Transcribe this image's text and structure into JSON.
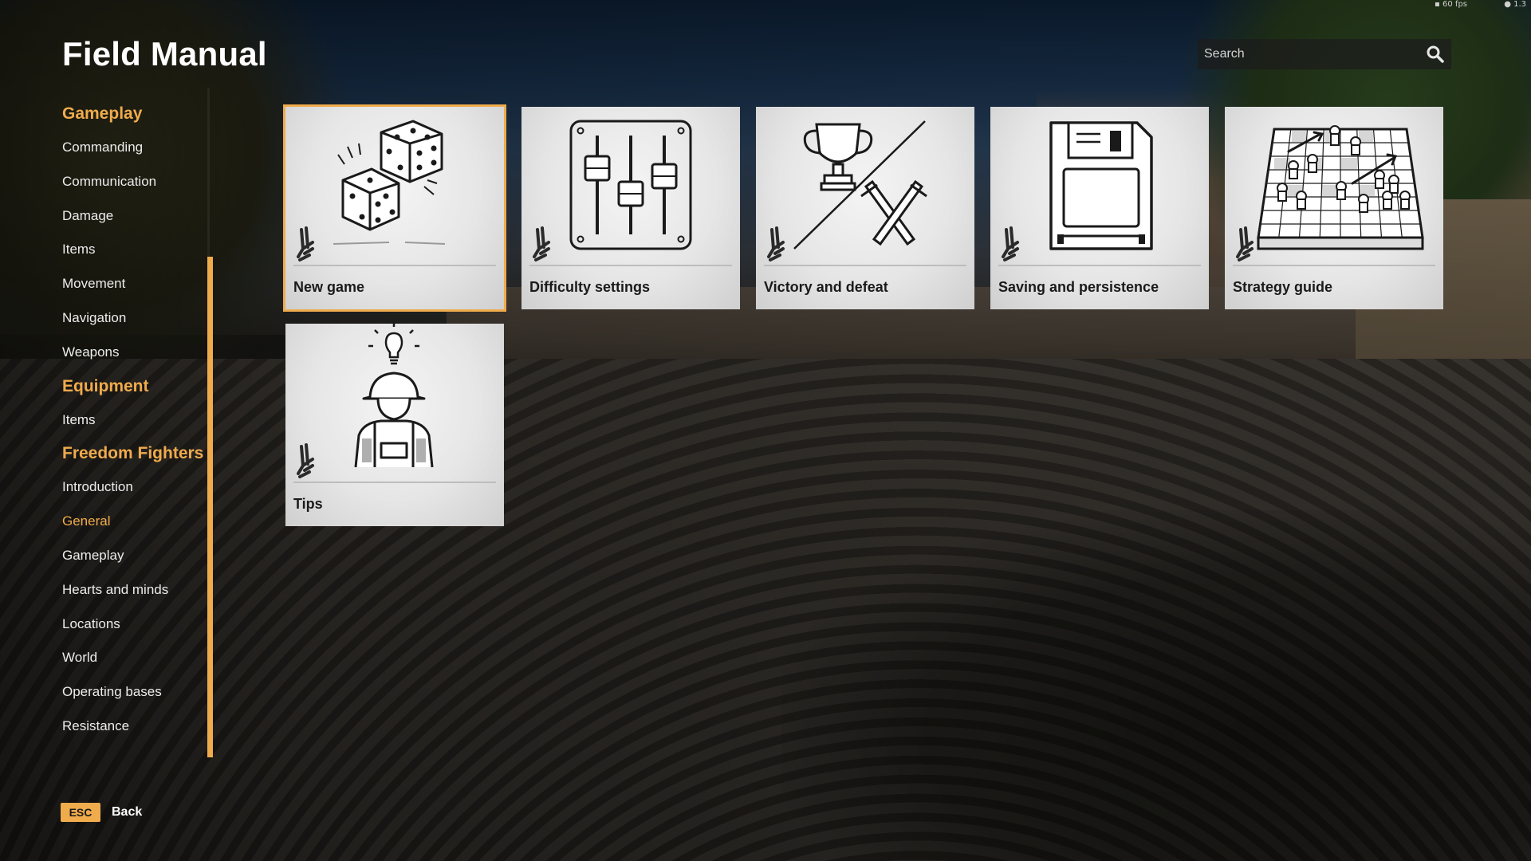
{
  "hud": {
    "fps": "60 fps",
    "version": "1.3"
  },
  "page": {
    "title": "Field Manual"
  },
  "search": {
    "placeholder": "Search",
    "icon": "search-icon"
  },
  "sidebar": {
    "sections": [
      {
        "title": "Gameplay",
        "items": [
          "Commanding",
          "Communication",
          "Damage",
          "Items",
          "Movement",
          "Navigation",
          "Weapons"
        ]
      },
      {
        "title": "Equipment",
        "items": [
          "Items"
        ]
      },
      {
        "title": "Freedom Fighters",
        "items": [
          "Introduction",
          "General",
          "Gameplay",
          "Hearts and minds",
          "Locations",
          "World",
          "Operating bases",
          "Resistance"
        ]
      }
    ],
    "active_item": "General"
  },
  "cards": [
    {
      "label": "New game",
      "icon": "dice-icon",
      "selected": true
    },
    {
      "label": "Difficulty settings",
      "icon": "sliders-icon",
      "selected": false
    },
    {
      "label": "Victory and defeat",
      "icon": "trophy-swords-icon",
      "selected": false
    },
    {
      "label": "Saving and persistence",
      "icon": "floppy-disk-icon",
      "selected": false
    },
    {
      "label": "Strategy guide",
      "icon": "chess-board-icon",
      "selected": false
    },
    {
      "label": "Tips",
      "icon": "soldier-lightbulb-icon",
      "selected": false
    }
  ],
  "footer": {
    "key": "ESC",
    "label": "Back"
  },
  "colors": {
    "accent": "#f0ab4c",
    "card_bg": "#e6e6e6",
    "text": "#ffffff"
  }
}
